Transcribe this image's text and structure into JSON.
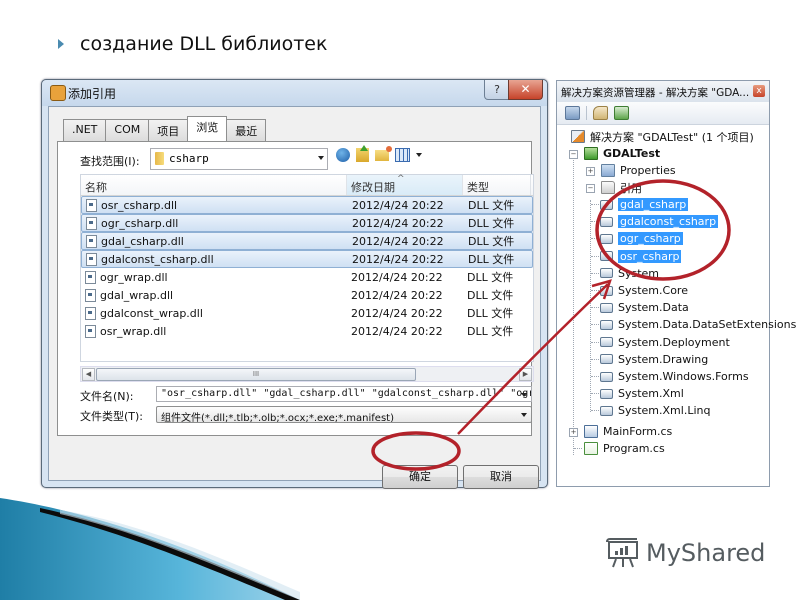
{
  "slide": {
    "title": "создание DLL библиотек",
    "logo_text": "MyShared"
  },
  "dialog": {
    "title": "添加引用",
    "help_label": "?",
    "close_label": "✕",
    "tabs": [
      {
        "label": ".NET",
        "active": false
      },
      {
        "label": "COM",
        "active": false
      },
      {
        "label": "项目",
        "active": false
      },
      {
        "label": "浏览",
        "active": true
      },
      {
        "label": "最近",
        "active": false
      }
    ],
    "look_in_label": "查找范围(I):",
    "look_in_value": "csharp",
    "columns": [
      "名称",
      "修改日期",
      "类型"
    ],
    "sort_indicator": "^",
    "files": [
      {
        "name": "osr_csharp.dll",
        "date": "2012/4/24 20:22",
        "type": "DLL 文件",
        "selected": true
      },
      {
        "name": "ogr_csharp.dll",
        "date": "2012/4/24 20:22",
        "type": "DLL 文件",
        "selected": true
      },
      {
        "name": "gdal_csharp.dll",
        "date": "2012/4/24 20:22",
        "type": "DLL 文件",
        "selected": true
      },
      {
        "name": "gdalconst_csharp.dll",
        "date": "2012/4/24 20:22",
        "type": "DLL 文件",
        "selected": true
      },
      {
        "name": "ogr_wrap.dll",
        "date": "2012/4/24 20:22",
        "type": "DLL 文件",
        "selected": false
      },
      {
        "name": "gdal_wrap.dll",
        "date": "2012/4/24 20:22",
        "type": "DLL 文件",
        "selected": false
      },
      {
        "name": "gdalconst_wrap.dll",
        "date": "2012/4/24 20:22",
        "type": "DLL 文件",
        "selected": false
      },
      {
        "name": "osr_wrap.dll",
        "date": "2012/4/24 20:22",
        "type": "DLL 文件",
        "selected": false
      }
    ],
    "scroll_thumb_glyph": "III",
    "filename_label": "文件名(N):",
    "filename_value": "\"osr_csharp.dll\" \"gdal_csharp.dll\" \"gdalconst_csharp.dll\" \"ogr_csharp.dll\"",
    "filetype_label": "文件类型(T):",
    "filetype_value": "组件文件(*.dll;*.tlb;*.olb;*.ocx;*.exe;*.manifest)",
    "ok_label": "确定",
    "cancel_label": "取消"
  },
  "solution_explorer": {
    "title": "解决方案资源管理器 - 解决方案 \"GDA...",
    "close_label": "x",
    "solution": "解决方案 \"GDALTest\" (1 个项目)",
    "project": "GDALTest",
    "properties": "Properties",
    "references_folder": "引用",
    "references": [
      {
        "name": "gdal_csharp",
        "selected": true
      },
      {
        "name": "gdalconst_csharp",
        "selected": true
      },
      {
        "name": "ogr_csharp",
        "selected": true
      },
      {
        "name": "osr_csharp",
        "selected": true
      },
      {
        "name": "System",
        "selected": false
      },
      {
        "name": "System.Core",
        "selected": false
      },
      {
        "name": "System.Data",
        "selected": false
      },
      {
        "name": "System.Data.DataSetExtensions",
        "selected": false
      },
      {
        "name": "System.Deployment",
        "selected": false
      },
      {
        "name": "System.Drawing",
        "selected": false
      },
      {
        "name": "System.Windows.Forms",
        "selected": false
      },
      {
        "name": "System.Xml",
        "selected": false
      },
      {
        "name": "System.Xml.Linq",
        "selected": false
      }
    ],
    "files": [
      "MainForm.cs",
      "Program.cs"
    ]
  },
  "colors": {
    "annotation_red": "#b3222a",
    "selection_blue": "#3399ff",
    "wave_teal": "#2f8fb5"
  }
}
